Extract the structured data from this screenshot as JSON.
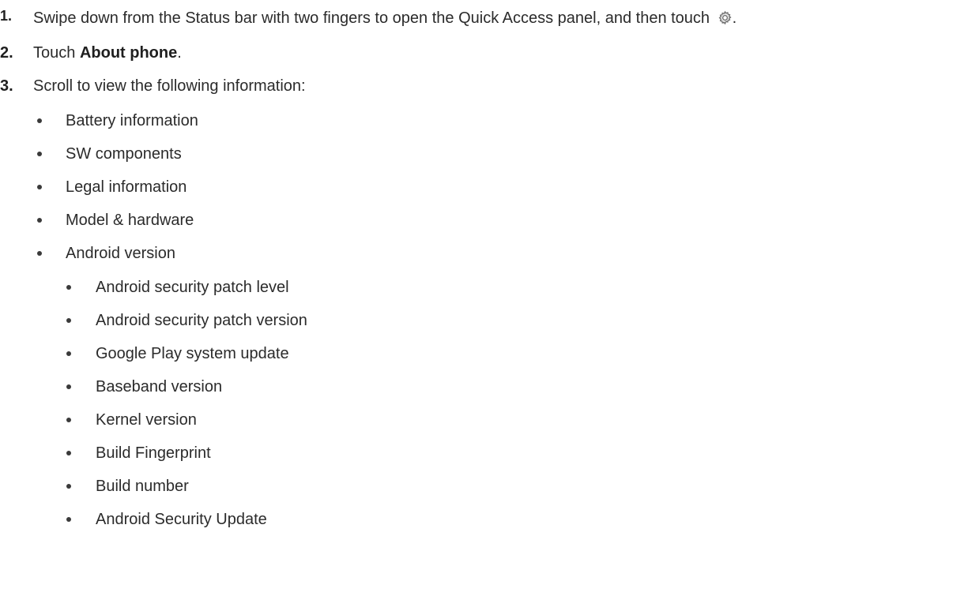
{
  "steps": [
    {
      "number": "1.",
      "text_before": "Swipe down from the Status bar with two fingers to open the Quick Access panel, and then touch",
      "icon": "settings-gear-icon",
      "text_after": "."
    },
    {
      "number": "2.",
      "text_before": "Touch ",
      "bold": "About phone",
      "text_after": "."
    },
    {
      "number": "3.",
      "text": "Scroll to view the following information:"
    }
  ],
  "info_items": [
    "Battery information",
    "SW components",
    "Legal information",
    "Model & hardware",
    "Android version"
  ],
  "android_version_items": [
    "Android security patch level",
    "Android security patch version",
    "Google Play system update",
    "Baseband version",
    "Kernel version",
    "Build Fingerprint",
    "Build number",
    "Android Security Update"
  ]
}
